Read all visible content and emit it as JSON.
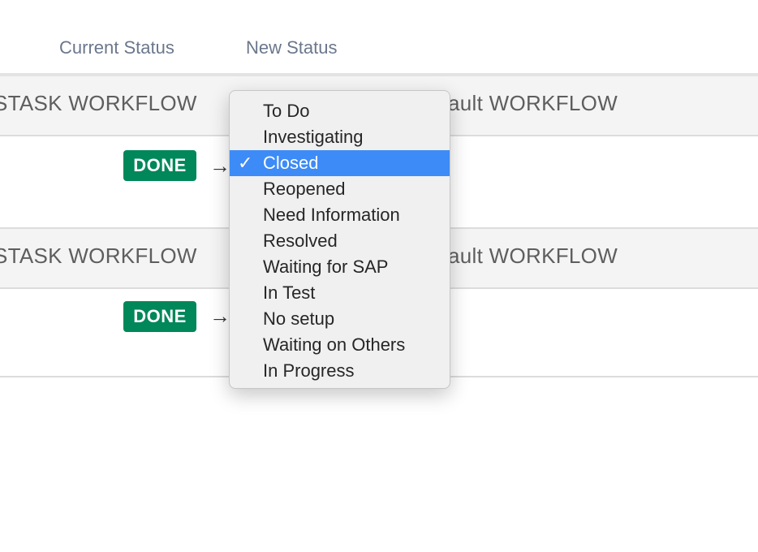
{
  "headers": {
    "current_status": "Current Status",
    "new_status": "New Status"
  },
  "rows": [
    {
      "left_workflow": "STASK WORKFLOW",
      "right_workflow": "ault WORKFLOW",
      "current_status": "DONE",
      "arrow": "→"
    },
    {
      "left_workflow": "STASK WORKFLOW",
      "right_workflow": "ault WORKFLOW",
      "current_status": "DONE",
      "arrow": "→"
    }
  ],
  "dropdown": {
    "selected_mark": "✓",
    "selected_index": 2,
    "options": [
      "To Do",
      "Investigating",
      "Closed",
      "Reopened",
      "Need Information",
      "Resolved",
      "Waiting for SAP",
      "In Test",
      "No setup",
      "Waiting on Others",
      "In Progress"
    ]
  },
  "colors": {
    "done_lozenge": "#00875a",
    "selected_highlight": "#3d8bf7",
    "header_text": "#6b778c"
  }
}
